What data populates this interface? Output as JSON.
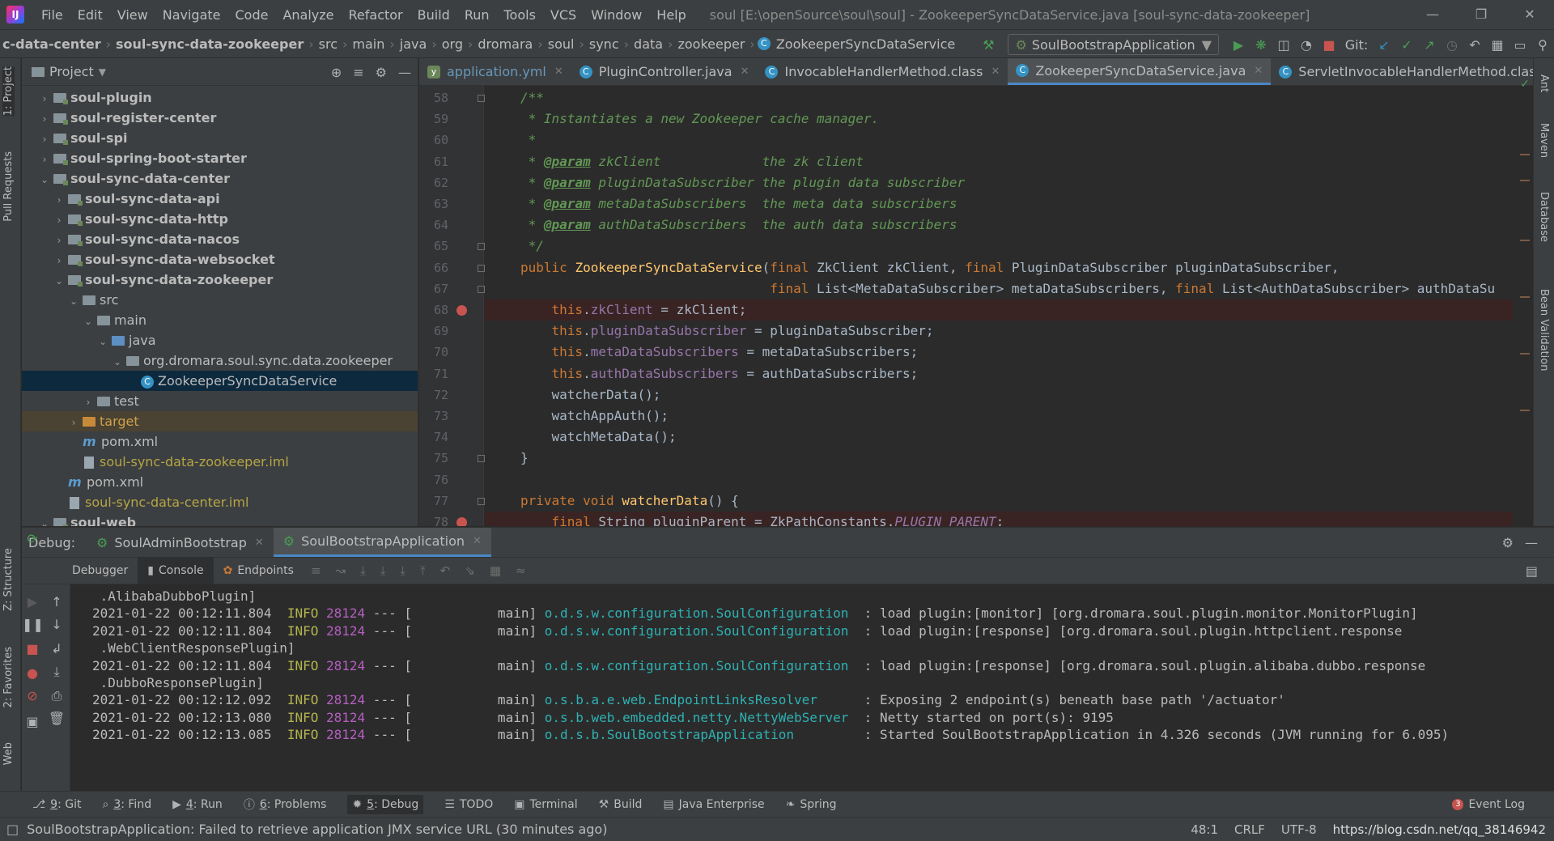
{
  "menu": {
    "items": [
      "File",
      "Edit",
      "View",
      "Navigate",
      "Code",
      "Analyze",
      "Refactor",
      "Build",
      "Run",
      "Tools",
      "VCS",
      "Window",
      "Help"
    ],
    "window_title": "soul [E:\\openSource\\soul\\soul] - ZookeeperSyncDataService.java [soul-sync-data-zookeeper]"
  },
  "navbar": {
    "crumbs": [
      "c-data-center",
      "soul-sync-data-zookeeper",
      "src",
      "main",
      "java",
      "org",
      "dromara",
      "soul",
      "sync",
      "data",
      "zookeeper",
      "ZookeeperSyncDataService"
    ],
    "run_config": "SoulBootstrapApplication",
    "git_label": "Git:"
  },
  "project": {
    "title": "Project",
    "tree": [
      {
        "label": "soul-plugin",
        "type": "module",
        "expanded": false
      },
      {
        "label": "soul-register-center",
        "type": "module",
        "expanded": false
      },
      {
        "label": "soul-spi",
        "type": "module",
        "expanded": false
      },
      {
        "label": "soul-spring-boot-starter",
        "type": "module",
        "expanded": false
      },
      {
        "label": "soul-sync-data-center",
        "type": "module",
        "expanded": true
      },
      {
        "label": "soul-sync-data-api",
        "type": "module",
        "expanded": false
      },
      {
        "label": "soul-sync-data-http",
        "type": "module",
        "expanded": false
      },
      {
        "label": "soul-sync-data-nacos",
        "type": "module",
        "expanded": false
      },
      {
        "label": "soul-sync-data-websocket",
        "type": "module",
        "expanded": false
      },
      {
        "label": "soul-sync-data-zookeeper",
        "type": "module",
        "expanded": true
      },
      {
        "label": "src",
        "type": "folder"
      },
      {
        "label": "main",
        "type": "folder"
      },
      {
        "label": "java",
        "type": "source"
      },
      {
        "label": "org.dromara.soul.sync.data.zookeeper",
        "type": "package"
      },
      {
        "label": "ZookeeperSyncDataService",
        "type": "class",
        "selected": true
      },
      {
        "label": "test",
        "type": "folder"
      },
      {
        "label": "target",
        "type": "excluded"
      },
      {
        "label": "pom.xml",
        "type": "maven"
      },
      {
        "label": "soul-sync-data-zookeeper.iml",
        "type": "iml"
      },
      {
        "label": "pom.xml",
        "type": "maven"
      },
      {
        "label": "soul-sync-data-center.iml",
        "type": "iml"
      },
      {
        "label": "soul-web",
        "type": "module",
        "expanded": true
      }
    ]
  },
  "editor": {
    "tabs": [
      {
        "label": "application.yml",
        "kind": "yml"
      },
      {
        "label": "PluginController.java",
        "kind": "class"
      },
      {
        "label": "InvocableHandlerMethod.class",
        "kind": "class"
      },
      {
        "label": "ZookeeperSyncDataService.java",
        "kind": "class",
        "active": true
      },
      {
        "label": "ServletInvocableHandlerMethod.class",
        "kind": "class"
      }
    ],
    "lines": [
      {
        "n": "58",
        "segs": [
          [
            "cm",
            "/**"
          ]
        ]
      },
      {
        "n": "59",
        "segs": [
          [
            "cm",
            " * Instantiates a new Zookeeper cache manager."
          ]
        ]
      },
      {
        "n": "60",
        "segs": [
          [
            "cm",
            " *"
          ]
        ]
      },
      {
        "n": "61",
        "segs": [
          [
            "cm",
            " * "
          ],
          [
            "tag",
            "@param"
          ],
          [
            "cm",
            " zkClient             the zk client"
          ]
        ]
      },
      {
        "n": "62",
        "segs": [
          [
            "cm",
            " * "
          ],
          [
            "tag",
            "@param"
          ],
          [
            "cm",
            " pluginDataSubscriber the plugin data subscriber"
          ]
        ]
      },
      {
        "n": "63",
        "segs": [
          [
            "cm",
            " * "
          ],
          [
            "tag",
            "@param"
          ],
          [
            "cm",
            " metaDataSubscribers  the meta data subscribers"
          ]
        ]
      },
      {
        "n": "64",
        "segs": [
          [
            "cm",
            " * "
          ],
          [
            "tag",
            "@param"
          ],
          [
            "cm",
            " authDataSubscribers  the auth data subscribers"
          ]
        ]
      },
      {
        "n": "65",
        "segs": [
          [
            "cm",
            " */"
          ]
        ]
      },
      {
        "n": "66",
        "segs": [
          [
            "kw",
            "public "
          ],
          [
            "fn",
            "ZookeeperSyncDataService"
          ],
          [
            "",
            "("
          ],
          [
            "kw",
            "final "
          ],
          [
            "",
            "ZkClient zkClient, "
          ],
          [
            "kw",
            "final "
          ],
          [
            "",
            "PluginDataSubscriber pluginDataSubscriber,"
          ]
        ]
      },
      {
        "n": "67",
        "segs": [
          [
            "",
            "                                "
          ],
          [
            "kw",
            "final "
          ],
          [
            "",
            "List<MetaDataSubscriber> metaDataSubscribers, "
          ],
          [
            "kw",
            "final "
          ],
          [
            "",
            "List<AuthDataSubscriber> authDataSu"
          ]
        ]
      },
      {
        "n": "68",
        "segs": [
          [
            "",
            "    "
          ],
          [
            "kw",
            "this"
          ],
          [
            "",
            "."
          ],
          [
            "fld",
            "zkClient"
          ],
          [
            "",
            " = zkClient;"
          ]
        ],
        "breakpoint": true
      },
      {
        "n": "69",
        "segs": [
          [
            "",
            "    "
          ],
          [
            "kw",
            "this"
          ],
          [
            "",
            "."
          ],
          [
            "fld",
            "pluginDataSubscriber"
          ],
          [
            "",
            " = pluginDataSubscriber;"
          ]
        ]
      },
      {
        "n": "70",
        "segs": [
          [
            "",
            "    "
          ],
          [
            "kw",
            "this"
          ],
          [
            "",
            "."
          ],
          [
            "fld",
            "metaDataSubscribers"
          ],
          [
            "",
            " = metaDataSubscribers;"
          ]
        ]
      },
      {
        "n": "71",
        "segs": [
          [
            "",
            "    "
          ],
          [
            "kw",
            "this"
          ],
          [
            "",
            "."
          ],
          [
            "fld",
            "authDataSubscribers"
          ],
          [
            "",
            " = authDataSubscribers;"
          ]
        ]
      },
      {
        "n": "72",
        "segs": [
          [
            "",
            "    watcherData();"
          ]
        ]
      },
      {
        "n": "73",
        "segs": [
          [
            "",
            "    watchAppAuth();"
          ]
        ]
      },
      {
        "n": "74",
        "segs": [
          [
            "",
            "    watchMetaData();"
          ]
        ]
      },
      {
        "n": "75",
        "segs": [
          [
            "",
            "}"
          ]
        ]
      },
      {
        "n": "76",
        "segs": [
          [
            "",
            ""
          ]
        ]
      },
      {
        "n": "77",
        "segs": [
          [
            "kw",
            "private void "
          ],
          [
            "fn",
            "watcherData"
          ],
          [
            "",
            "() {"
          ]
        ]
      },
      {
        "n": "78",
        "segs": [
          [
            "",
            "    "
          ],
          [
            "kw",
            "final "
          ],
          [
            "",
            "String pluginParent = ZkPathConstants."
          ],
          [
            "cst",
            "PLUGIN_PARENT"
          ],
          [
            "",
            ";"
          ]
        ],
        "breakpoint": true
      }
    ]
  },
  "debug": {
    "label": "Debug:",
    "sessions": [
      {
        "label": "SoulAdminBootstrap"
      },
      {
        "label": "SoulBootstrapApplication",
        "active": true
      }
    ],
    "subtabs": [
      "Debugger",
      "Console",
      "Endpoints"
    ],
    "log": [
      {
        "cont": " .AlibabaDubboPlugin]"
      },
      {
        "ts": "2021-01-22 00:12:11.804",
        "lvl": "INFO",
        "pid": "28124",
        "mid": " --- [           main] ",
        "cls": "o.d.s.w.configuration.SoulConfiguration ",
        "msg": " : load plugin:[monitor] [org.dromara.soul.plugin.monitor.MonitorPlugin]"
      },
      {
        "ts": "2021-01-22 00:12:11.804",
        "lvl": "INFO",
        "pid": "28124",
        "mid": " --- [           main] ",
        "cls": "o.d.s.w.configuration.SoulConfiguration ",
        "msg": " : load plugin:[response] [org.dromara.soul.plugin.httpclient.response"
      },
      {
        "cont": " .WebClientResponsePlugin]"
      },
      {
        "ts": "2021-01-22 00:12:11.804",
        "lvl": "INFO",
        "pid": "28124",
        "mid": " --- [           main] ",
        "cls": "o.d.s.w.configuration.SoulConfiguration ",
        "msg": " : load plugin:[response] [org.dromara.soul.plugin.alibaba.dubbo.response"
      },
      {
        "cont": " .DubboResponsePlugin]"
      },
      {
        "ts": "2021-01-22 00:12:12.092",
        "lvl": "INFO",
        "pid": "28124",
        "mid": " --- [           main] ",
        "cls": "o.s.b.a.e.web.EndpointLinksResolver     ",
        "msg": " : Exposing 2 endpoint(s) beneath base path '/actuator'"
      },
      {
        "ts": "2021-01-22 00:12:13.080",
        "lvl": "INFO",
        "pid": "28124",
        "mid": " --- [           main] ",
        "cls": "o.s.b.web.embedded.netty.NettyWebServer ",
        "msg": " : Netty started on port(s): 9195"
      },
      {
        "ts": "2021-01-22 00:12:13.085",
        "lvl": "INFO",
        "pid": "28124",
        "mid": " --- [           main] ",
        "cls": "o.d.s.b.SoulBootstrapApplication        ",
        "msg": " : Started SoulBootstrapApplication in 4.326 seconds (JVM running for 6.095)"
      }
    ]
  },
  "bottom_tools": [
    {
      "num": "9",
      "label": ": Git",
      "icon": "git-icon"
    },
    {
      "num": "3",
      "label": ": Find",
      "icon": "search-icon"
    },
    {
      "num": "4",
      "label": ": Run",
      "icon": "run-icon"
    },
    {
      "num": "6",
      "label": ": Problems",
      "icon": "problems-icon"
    },
    {
      "num": "5",
      "label": ": Debug",
      "icon": "debug-icon",
      "active": true
    },
    {
      "num": "",
      "label": "TODO",
      "icon": "todo-icon"
    },
    {
      "num": "",
      "label": "Terminal",
      "icon": "terminal-icon"
    },
    {
      "num": "",
      "label": "Build",
      "icon": "build-icon"
    },
    {
      "num": "",
      "label": "Java Enterprise",
      "icon": "java-enterprise-icon"
    },
    {
      "num": "",
      "label": "Spring",
      "icon": "spring-icon"
    }
  ],
  "event_log": {
    "label": "Event Log",
    "count": "3"
  },
  "left_stripe": [
    "1: Project",
    "Pull Requests",
    "Z: Structure",
    "2: Favorites",
    "Web"
  ],
  "right_stripe": [
    "Ant",
    "Maven",
    "Database",
    "Bean Validation"
  ],
  "status": {
    "message": "SoulBootstrapApplication: Failed to retrieve application JMX service URL (30 minutes ago)",
    "position": "48:1",
    "line_sep": "CRLF",
    "encoding": "UTF-8",
    "watermark": "https://blog.csdn.net/qq_38146942"
  }
}
